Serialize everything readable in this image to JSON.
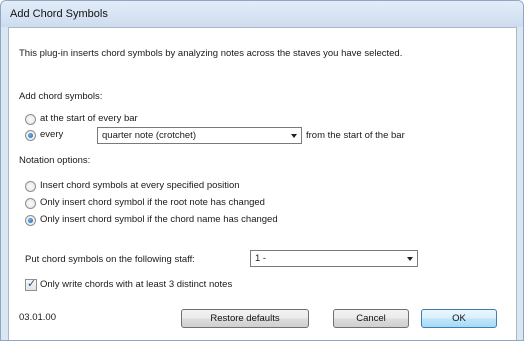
{
  "window": {
    "title": "Add Chord Symbols"
  },
  "description": "This plug-in inserts chord symbols by analyzing notes across the staves you have selected.",
  "add_chord_symbols": {
    "label": "Add chord symbols:",
    "option_start_of_bar": {
      "label": "at the start of every bar",
      "checked": false
    },
    "option_every": {
      "label": "every",
      "checked": true
    },
    "duration_select": {
      "value": "quarter note (crotchet)"
    },
    "suffix": "from the start of the bar"
  },
  "notation_options": {
    "label": "Notation options:",
    "options": [
      {
        "label": "Insert chord symbols at every specified position",
        "checked": false
      },
      {
        "label": "Only insert chord symbol if the root note has changed",
        "checked": false
      },
      {
        "label": "Only insert chord symbol if the chord name has changed",
        "checked": true
      }
    ]
  },
  "staff": {
    "label": "Put chord symbols on the following staff:",
    "value": "1 -"
  },
  "distinct_notes": {
    "label": "Only write chords with at least 3 distinct notes",
    "checked": true
  },
  "footer": {
    "version": "03.01.00",
    "restore_label": "Restore defaults",
    "cancel_label": "Cancel",
    "ok_label": "OK"
  }
}
